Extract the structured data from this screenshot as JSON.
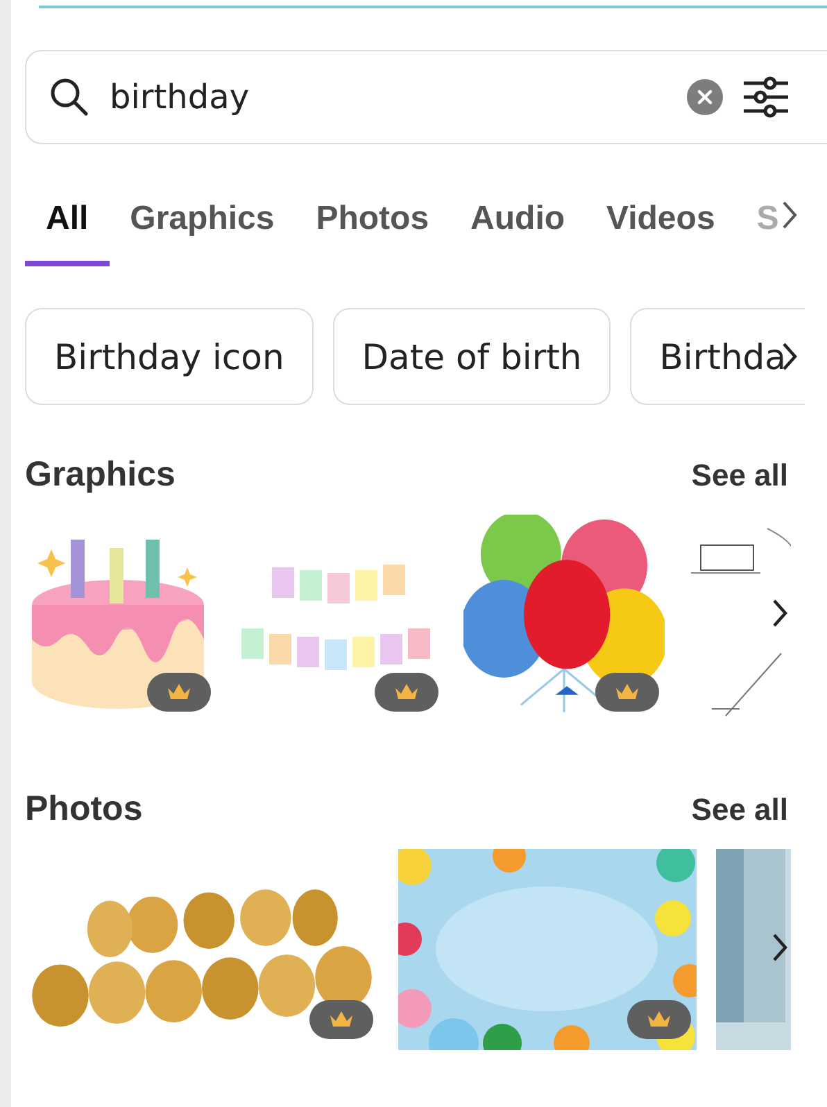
{
  "search": {
    "value": "birthday"
  },
  "tabs": [
    {
      "label": "All",
      "selected": true
    },
    {
      "label": "Graphics",
      "selected": false
    },
    {
      "label": "Photos",
      "selected": false
    },
    {
      "label": "Audio",
      "selected": false
    },
    {
      "label": "Videos",
      "selected": false
    },
    {
      "label": "S",
      "selected": false
    }
  ],
  "suggestions": [
    "Birthday icon",
    "Date of birth",
    "Birthda"
  ],
  "sections": [
    {
      "title": "Graphics",
      "link": "See all",
      "items": [
        {
          "premium": true
        },
        {
          "premium": true
        },
        {
          "premium": true
        },
        {
          "premium": false
        }
      ]
    },
    {
      "title": "Photos",
      "link": "See all",
      "items": [
        {
          "premium": true
        },
        {
          "premium": true
        },
        {
          "premium": false
        }
      ]
    }
  ]
}
